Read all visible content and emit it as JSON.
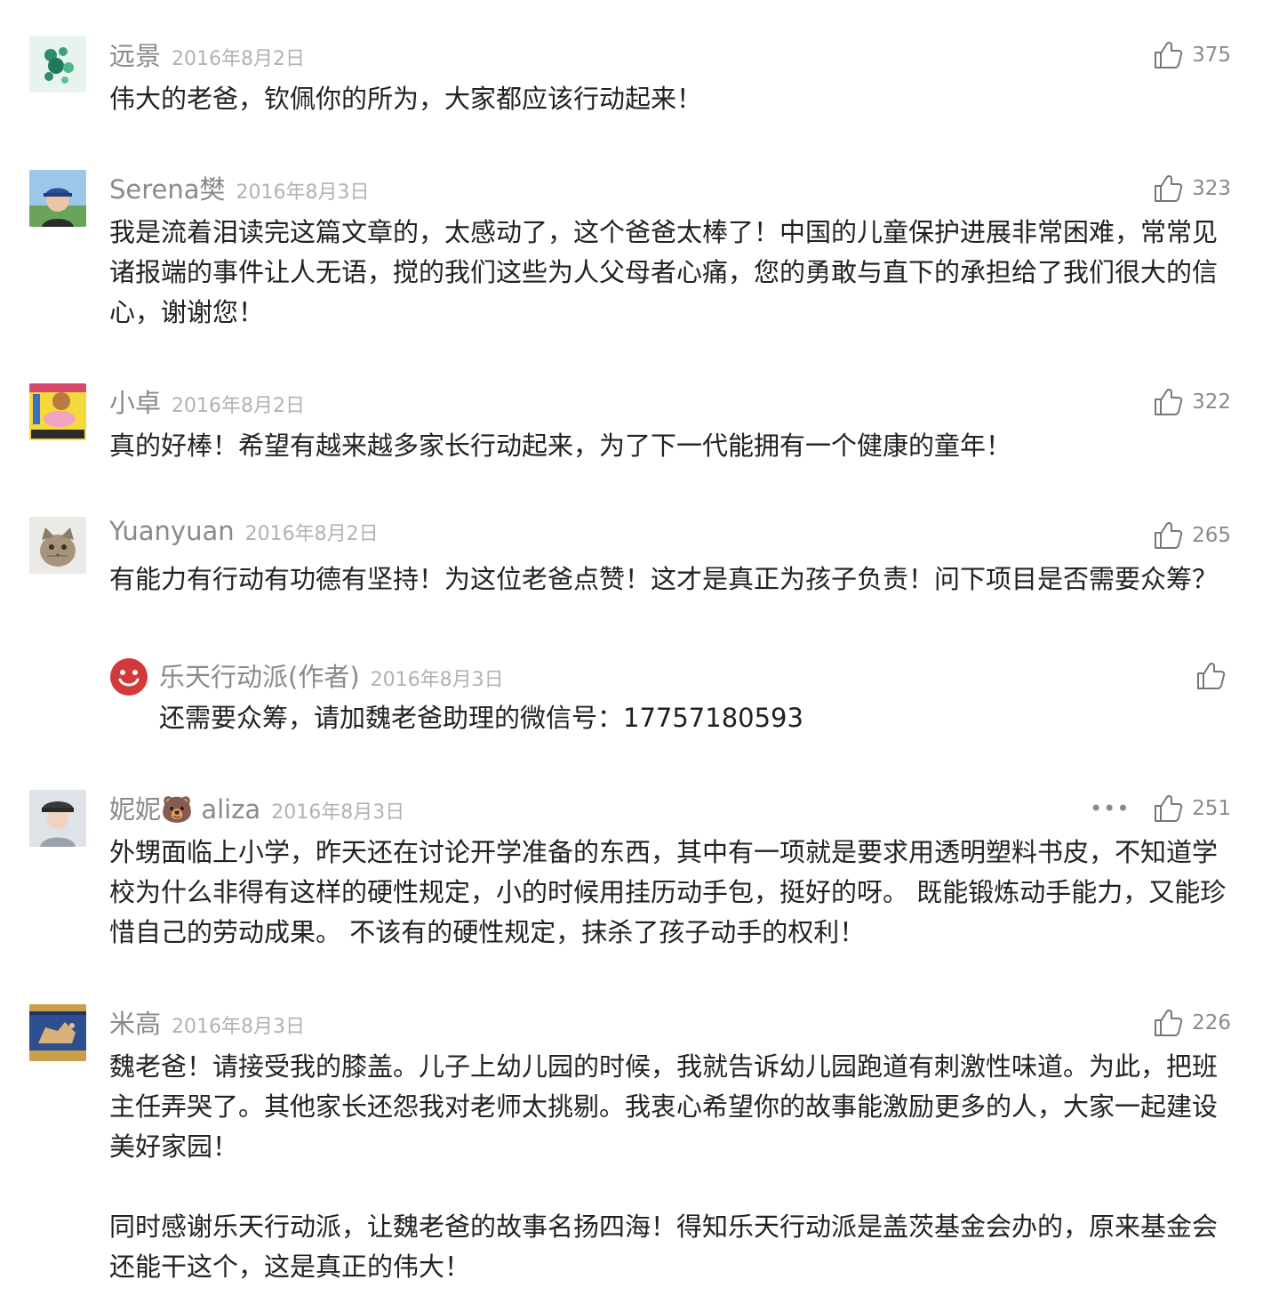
{
  "comments": [
    {
      "name": "远景",
      "date": "2016年8月2日",
      "likes": "375",
      "text": "伟大的老爸，钦佩你的所为，大家都应该行动起来！"
    },
    {
      "name": "Serena樊",
      "date": "2016年8月3日",
      "likes": "323",
      "text": "我是流着泪读完这篇文章的，太感动了，这个爸爸太棒了！中国的儿童保护进展非常困难，常常见诸报端的事件让人无语，搅的我们这些为人父母者心痛，您的勇敢与直下的承担给了我们很大的信心，谢谢您！"
    },
    {
      "name": "小卓",
      "date": "2016年8月2日",
      "likes": "322",
      "text": "真的好棒！希望有越来越多家长行动起来，为了下一代能拥有一个健康的童年！"
    },
    {
      "name": "Yuanyuan",
      "date": "2016年8月2日",
      "likes": "265",
      "text": "有能力有行动有功德有坚持！为这位老爸点赞！这才是真正为孩子负责！问下项目是否需要众筹？",
      "reply": {
        "name": "乐天行动派(作者)",
        "date": "2016年8月3日",
        "text": "还需要众筹，请加魏老爸助理的微信号：17757180593"
      }
    },
    {
      "name": "妮妮🐻 aliza",
      "date": "2016年8月3日",
      "likes": "251",
      "more": "•••",
      "text": "外甥面临上小学，昨天还在讨论开学准备的东西，其中有一项就是要求用透明塑料书皮，不知道学校为什么非得有这样的硬性规定，小的时候用挂历动手包，挺好的呀。 既能锻炼动手能力，又能珍惜自己的劳动成果。 不该有的硬性规定，抹杀了孩子动手的权利！"
    },
    {
      "name": "米高",
      "date": "2016年8月3日",
      "likes": "226",
      "text": "魏老爸！请接受我的膝盖。儿子上幼儿园的时候，我就告诉幼儿园跑道有刺激性味道。为此，把班主任弄哭了。其他家长还怨我对老师太挑剔。我衷心希望你的故事能激励更多的人，大家一起建设美好家园！\n\n同时感谢乐天行动派，让魏老爸的故事名扬四海！得知乐天行动派是盖茨基金会办的，原来基金会还能干这个，这是真正的伟大！"
    }
  ]
}
